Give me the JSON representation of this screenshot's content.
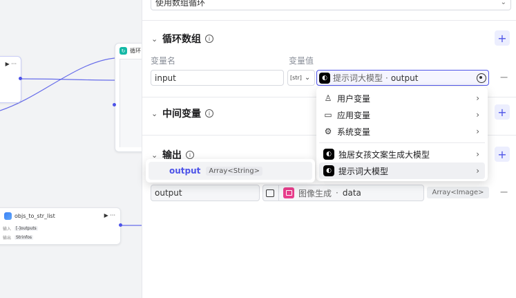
{
  "canvas": {
    "loop_node_label": "循环",
    "objs_node": {
      "title": "objs_to_str_list",
      "input_label": "输入",
      "input_type": "[-]",
      "input_value": "outputs",
      "output_label": "输出",
      "output_type": "Str",
      "output_value": "infos"
    },
    "node_controls": "▶ ···"
  },
  "panel": {
    "top_select_value": "使用数组循环",
    "loop_array": {
      "title": "循环数组",
      "col_name": "变量名",
      "col_value": "变量值",
      "row": {
        "name": "input",
        "type_label": "[str]",
        "ref_source": "提示词大模型",
        "ref_separator": " · ",
        "ref_field": "output"
      }
    },
    "dropdown": {
      "items": [
        {
          "icon": "user-icon",
          "label": "用户变量"
        },
        {
          "icon": "folder-icon",
          "label": "应用变量"
        },
        {
          "icon": "gear-icon",
          "label": "系统变量"
        }
      ],
      "nodes": [
        {
          "label": "独居女孩文案生成大模型"
        },
        {
          "label": "提示词大模型"
        }
      ]
    },
    "submenu": {
      "name": "output",
      "type": "Array<String>"
    },
    "intermediate": {
      "title": "中间变量"
    },
    "output": {
      "title": "输出",
      "row": {
        "name": "output",
        "ref_source": "图像生成",
        "ref_separator": " · ",
        "ref_field": "data",
        "type": "Array<Image>"
      }
    }
  },
  "colors": {
    "accent": "#4d53e8",
    "connector": "#4d53e8"
  }
}
